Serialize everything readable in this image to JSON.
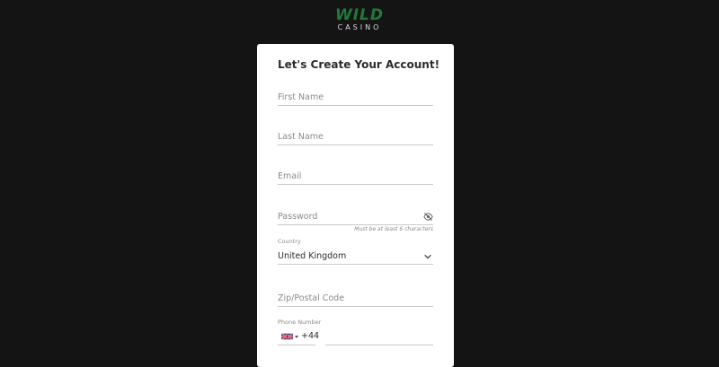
{
  "logo": {
    "main": "WILD",
    "sub": "CASINO"
  },
  "form": {
    "title": "Let's Create Your Account!",
    "first_name_placeholder": "First Name",
    "last_name_placeholder": "Last Name",
    "email_placeholder": "Email",
    "password_placeholder": "Password",
    "password_hint": "Must be at least 6 characters",
    "country_label": "Country",
    "country_value": "United Kingdom",
    "zip_placeholder": "Zip/Postal Code",
    "phone_label": "Phone Number",
    "phone_code": "+44"
  },
  "icons": {
    "password_toggle": "eye-slash-icon",
    "country_dropdown": "chevron-down-icon",
    "flag": "uk-flag-icon"
  },
  "colors": {
    "background": "#141414",
    "card": "#ffffff",
    "brand_green": "#1f7a3a"
  }
}
